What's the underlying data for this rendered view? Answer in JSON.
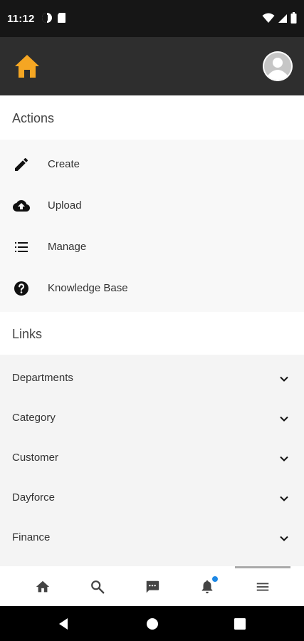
{
  "status_bar": {
    "time": "11:12",
    "icons": [
      "data-saver-icon",
      "sim-card-icon",
      "wifi-icon",
      "signal-icon",
      "battery-icon"
    ]
  },
  "header": {
    "logo_icon": "home-icon",
    "logo_color": "#f5a623",
    "avatar_icon": "user-avatar-icon"
  },
  "actions": {
    "title": "Actions",
    "items": [
      {
        "label": "Create",
        "icon": "pencil-icon"
      },
      {
        "label": "Upload",
        "icon": "cloud-upload-icon"
      },
      {
        "label": "Manage",
        "icon": "list-icon"
      },
      {
        "label": "Knowledge Base",
        "icon": "help-circle-icon"
      }
    ]
  },
  "links": {
    "title": "Links",
    "items": [
      {
        "label": "Departments",
        "icon": "chevron-down-icon"
      },
      {
        "label": "Category",
        "icon": "chevron-down-icon"
      },
      {
        "label": "Customer",
        "icon": "chevron-down-icon"
      },
      {
        "label": "Dayforce",
        "icon": "chevron-down-icon"
      },
      {
        "label": "Finance",
        "icon": "chevron-down-icon"
      }
    ]
  },
  "bottom_nav": {
    "items": [
      {
        "name": "home",
        "icon": "home-icon"
      },
      {
        "name": "search",
        "icon": "search-icon"
      },
      {
        "name": "messages",
        "icon": "chat-icon"
      },
      {
        "name": "notifications",
        "icon": "bell-icon",
        "badge": true
      },
      {
        "name": "menu",
        "icon": "menu-icon",
        "active": true
      }
    ],
    "badge_color": "#1e88e5"
  },
  "system_nav": [
    "back-icon",
    "home-circle-icon",
    "recents-icon"
  ]
}
